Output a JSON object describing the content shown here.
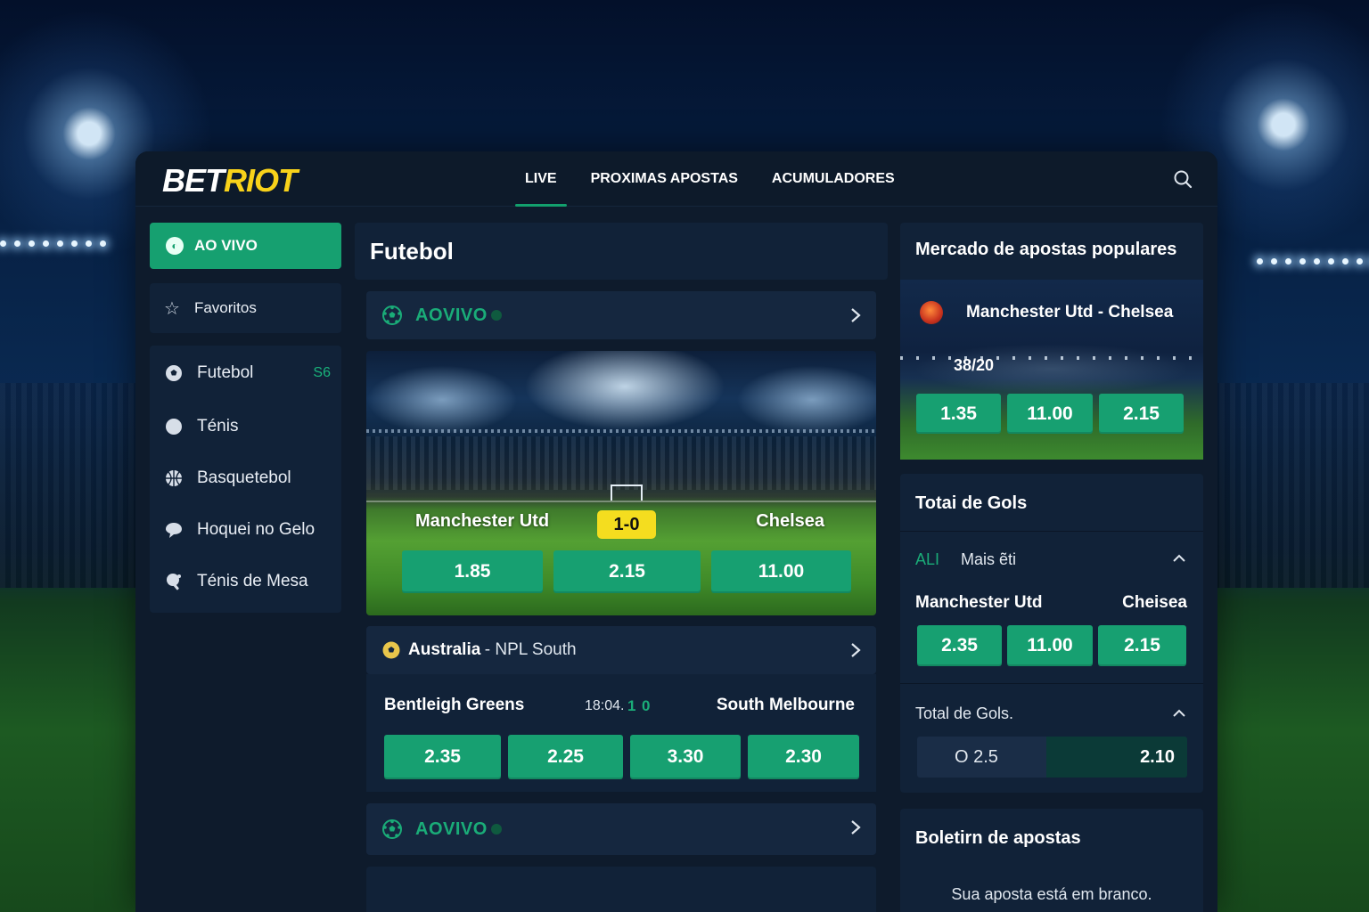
{
  "brand": {
    "logo_part1": "BET",
    "logo_part2": "RIOT"
  },
  "nav": {
    "items": [
      "LIVE",
      "PROXIMAS APOSTAS",
      "ACUMULADORES"
    ],
    "active": "LIVE"
  },
  "sidebar": {
    "live_button": "AO VIVO",
    "favorites": "Favoritos",
    "sports": [
      {
        "label": "Futebol",
        "count": "S6",
        "icon": "soccer-ball-icon"
      },
      {
        "label": "Ténis",
        "count": "",
        "icon": "tennis-ball-icon"
      },
      {
        "label": "Basquetebol",
        "count": "",
        "icon": "basketball-icon"
      },
      {
        "label": "Hoquei no Gelo",
        "count": "",
        "icon": "hockey-puck-icon"
      },
      {
        "label": "Ténis de Mesa",
        "count": "",
        "icon": "table-tennis-icon"
      }
    ]
  },
  "main": {
    "title": "Futebol",
    "live_header": "AOVIVO",
    "featured": {
      "home": "Manchester Utd",
      "away": "Chelsea",
      "score": "1-0",
      "odds": [
        "1.85",
        "2.15",
        "11.00"
      ]
    },
    "league": {
      "country": "Australia",
      "name": "- NPL South"
    },
    "match2": {
      "home": "Bentleigh Greens",
      "away": "South Melbourne",
      "time": "18:04.",
      "score_home": "1",
      "score_away": "0",
      "odds": [
        "2.35",
        "2.25",
        "3.30",
        "2.30"
      ]
    },
    "live_header2": "AOVIVO"
  },
  "popular": {
    "title": "Mercado de apostas populares",
    "match": "Manchester Utd - Chelsea",
    "time": "38/20",
    "odds": [
      "1.35",
      "11.00",
      "2.15"
    ]
  },
  "goals": {
    "title": "Totai de Gols",
    "tab_all": "ALI",
    "tab_more": "Mais ẽti",
    "home": "Manchester Utd",
    "away": "Cheisea",
    "odds": [
      "2.35",
      "11.00",
      "2.15"
    ],
    "subtitle": "Total de Gols.",
    "over_label": "O 2.5",
    "over_odds": "2.10"
  },
  "betslip": {
    "title": "Boletirn de apostas",
    "empty_text": "Sua aposta está em branco."
  },
  "colors": {
    "accent": "#16a070",
    "brand_yellow": "#f8d21a",
    "panel": "#112238",
    "background": "#0e1b2c"
  }
}
